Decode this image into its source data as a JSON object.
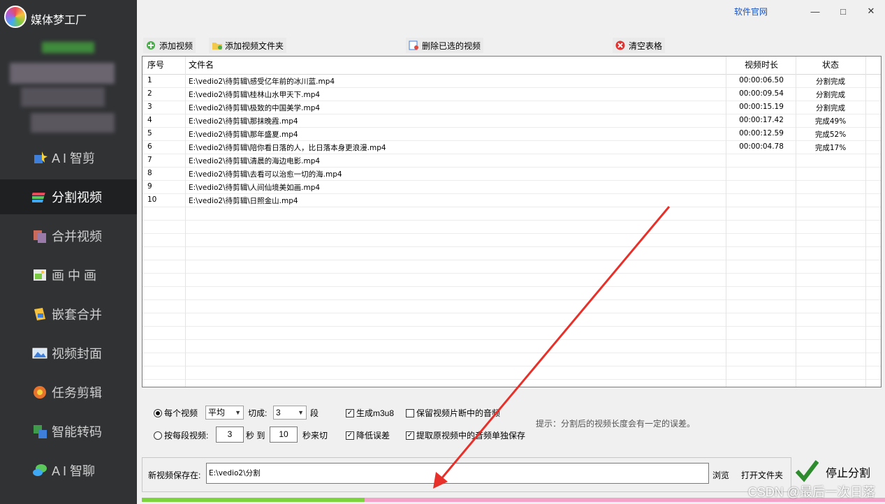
{
  "app": {
    "title": "媒体梦工厂"
  },
  "window": {
    "site_link": "软件官网",
    "minimize": "—",
    "maximize": "□",
    "close": "✕"
  },
  "sidebar": {
    "items": [
      {
        "label": "A I 智剪",
        "icon": "ai-edit-icon"
      },
      {
        "label": "分割视频",
        "icon": "split-video-icon",
        "active": true
      },
      {
        "label": "合并视频",
        "icon": "merge-video-icon"
      },
      {
        "label": "画 中 画",
        "icon": "picture-in-picture-icon"
      },
      {
        "label": "嵌套合并",
        "icon": "nest-merge-icon"
      },
      {
        "label": "视频封面",
        "icon": "video-cover-icon"
      },
      {
        "label": "任务剪辑",
        "icon": "task-edit-icon"
      },
      {
        "label": "智能转码",
        "icon": "smart-transcode-icon"
      },
      {
        "label": "A I 智聊",
        "icon": "ai-chat-icon"
      }
    ]
  },
  "toolbar": {
    "add_video": "添加视频",
    "add_folder": "添加视频文件夹",
    "delete_selected": "删除已选的视频",
    "clear_table": "清空表格"
  },
  "table": {
    "headers": {
      "no": "序号",
      "name": "文件名",
      "duration": "视频时长",
      "status": "状态"
    },
    "rows": [
      {
        "no": "1",
        "name": "E:\\vedio2\\待剪辑\\感受亿年前的冰川蓝.mp4",
        "duration": "00:00:06.50",
        "status": "分割完成"
      },
      {
        "no": "2",
        "name": "E:\\vedio2\\待剪辑\\桂林山水甲天下.mp4",
        "duration": "00:00:09.54",
        "status": "分割完成"
      },
      {
        "no": "3",
        "name": "E:\\vedio2\\待剪辑\\极致的中国美学.mp4",
        "duration": "00:00:15.19",
        "status": "分割完成"
      },
      {
        "no": "4",
        "name": "E:\\vedio2\\待剪辑\\那抹晚霞.mp4",
        "duration": "00:00:17.42",
        "status": "完成49%"
      },
      {
        "no": "5",
        "name": "E:\\vedio2\\待剪辑\\那年盛夏.mp4",
        "duration": "00:00:12.59",
        "status": "完成52%"
      },
      {
        "no": "6",
        "name": "E:\\vedio2\\待剪辑\\陪你看日落的人，比日落本身更浪漫.mp4",
        "duration": "00:00:04.78",
        "status": "完成17%"
      },
      {
        "no": "7",
        "name": "E:\\vedio2\\待剪辑\\清晨的海边电影.mp4",
        "duration": "",
        "status": ""
      },
      {
        "no": "8",
        "name": "E:\\vedio2\\待剪辑\\去看可以治愈一切的海.mp4",
        "duration": "",
        "status": ""
      },
      {
        "no": "9",
        "name": "E:\\vedio2\\待剪辑\\人间仙境美如画.mp4",
        "duration": "",
        "status": ""
      },
      {
        "no": "10",
        "name": "E:\\vedio2\\待剪辑\\日照金山.mp4",
        "duration": "",
        "status": ""
      }
    ]
  },
  "options": {
    "per_video_label": "每个视频",
    "mode_value": "平均",
    "cut_label": "切成:",
    "segments_value": "3",
    "segments_unit": "段",
    "gen_m3u8": "生成m3u8",
    "keep_audio": "保留视频片断中的音频",
    "per_segment_label": "按每段视频:",
    "from_value": "3",
    "sec_to": "秒 到",
    "to_value": "10",
    "sec_cut": "秒来切",
    "reduce_error": "降低误差",
    "extract_audio": "提取原视频中的音频单独保存",
    "hint": "提示：分割后的视频长度会有一定的误差。"
  },
  "output": {
    "save_label": "新视频保存在:",
    "save_path": "E:\\vedio2\\分割",
    "browse": "浏览",
    "open_folder": "打开文件夹",
    "stop": "停止分割"
  },
  "progress": {
    "fraction": 0.3
  },
  "watermark": "CSDN @最后一次日落"
}
